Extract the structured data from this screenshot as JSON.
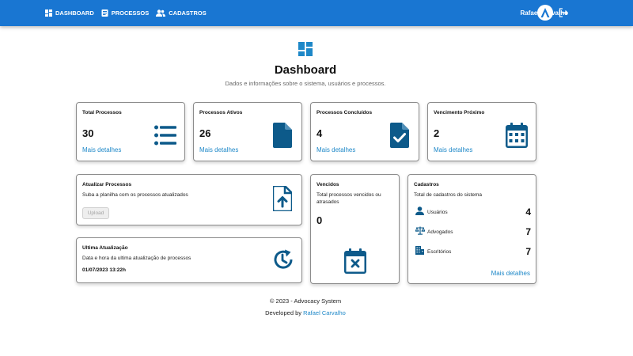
{
  "nav": {
    "items": [
      {
        "label": "DASHBOARD",
        "icon": "dashboard-icon"
      },
      {
        "label": "PROCESSOS",
        "icon": "document-icon"
      },
      {
        "label": "CADASTROS",
        "icon": "people-icon"
      }
    ],
    "user_name": "Rafael Carvalho"
  },
  "header": {
    "title": "Dashboard",
    "subtitle": "Dados e informações sobre o sistema, usuários e processos."
  },
  "stats": [
    {
      "title": "Total Processos",
      "value": "30",
      "link": "Mais detalhes",
      "icon": "list-icon"
    },
    {
      "title": "Processos Ativos",
      "value": "26",
      "link": "Mais detalhes",
      "icon": "file-icon"
    },
    {
      "title": "Processos Concluídos",
      "value": "4",
      "link": "Mais detalhes",
      "icon": "file-check-icon"
    },
    {
      "title": "Vencimento Próximo",
      "value": "2",
      "link": "Mais detalhes",
      "icon": "calendar-icon"
    }
  ],
  "atualizar": {
    "title": "Atualizar Processos",
    "text": "Suba a planilha com os processos atualizados",
    "button": "Upload"
  },
  "ultima": {
    "title": "Ultima Atualização",
    "text": "Data e hora da ultima atualização de processos",
    "datetime": "01/07/2023 13:22h"
  },
  "vencidos": {
    "title": "Vencidos",
    "text": "Total processos vencidos ou atrasados",
    "value": "0"
  },
  "cadastros": {
    "title": "Cadastros",
    "text": "Total de cadastros do sistema",
    "rows": [
      {
        "label": "Usuários",
        "value": "4",
        "icon": "person-icon"
      },
      {
        "label": "Advogados",
        "value": "7",
        "icon": "scale-icon"
      },
      {
        "label": "Escritórios",
        "value": "7",
        "icon": "building-icon"
      }
    ],
    "link": "Mais detalhes"
  },
  "footer": {
    "copyright": "© 2023 - Advocacy System",
    "developed_prefix": "Developed by ",
    "developer": "Rafael Carvalho"
  },
  "colors": {
    "primary": "#1976d2",
    "icon": "#0d5a8a",
    "link": "#1e88c8"
  }
}
